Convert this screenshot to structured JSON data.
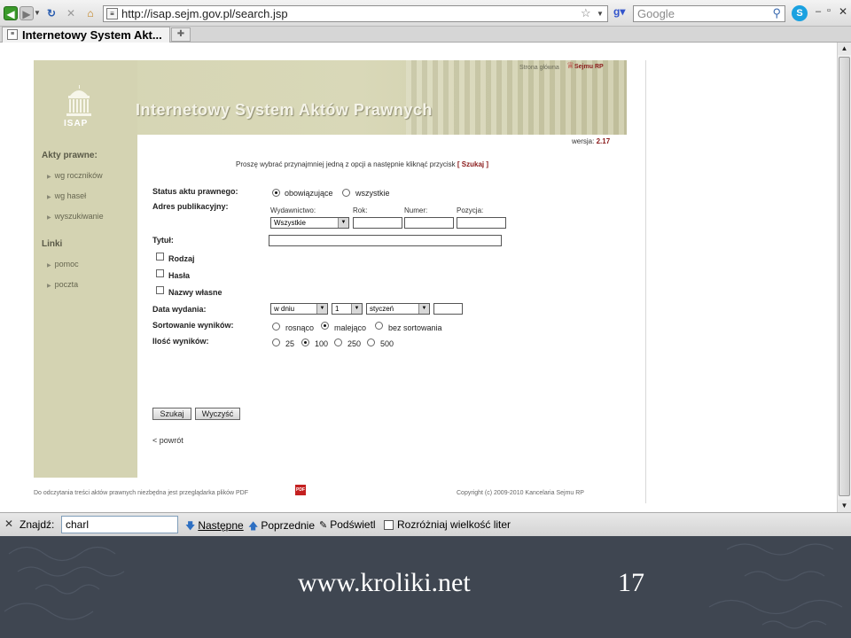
{
  "browser": {
    "url": "http://isap.sejm.gov.pl/search.jsp",
    "search_placeholder": "Google",
    "tab_title": "Internetowy System Akt..."
  },
  "site": {
    "logo_text": "ISAP",
    "title": "Internetowy System Aktów Prawnych",
    "home_link": "Strona główna",
    "sejm_link": "Sejmu RP",
    "version_label": "wersja:",
    "version_value": "2.17"
  },
  "sidebar": {
    "heading_acts": "Akty prawne:",
    "acts_items": [
      "wg roczników",
      "wg haseł",
      "wyszukiwanie"
    ],
    "heading_links": "Linki",
    "links_items": [
      "pomoc",
      "poczta"
    ]
  },
  "form": {
    "instruction": "Proszę wybrać przynajmniej jedną z opcji a następnie kliknąć przycisk",
    "instruction_button": "[ Szukaj ]",
    "status_label": "Status aktu prawnego:",
    "status_options": [
      "obowiązujące",
      "wszystkie"
    ],
    "status_selected": "obowiązujące",
    "publication_label": "Adres publikacyjny:",
    "publisher_label": "Wydawnictwo:",
    "year_label": "Rok:",
    "number_label": "Numer:",
    "position_label": "Pozycja:",
    "publisher_value": "Wszystkie",
    "title_label": "Tytuł:",
    "checkbox_type": "Rodzaj",
    "checkbox_keywords": "Hasła",
    "checkbox_names": "Nazwy własne",
    "date_label": "Data wydania:",
    "date_mode": "w dniu",
    "date_day": "1",
    "date_month": "styczeń",
    "sort_label": "Sortowanie wyników:",
    "sort_options": [
      "rosnąco",
      "malejąco",
      "bez sortowania"
    ],
    "sort_selected": "malejąco",
    "count_label": "Ilość wyników:",
    "count_options": [
      "25",
      "100",
      "250",
      "500"
    ],
    "count_selected": "100",
    "search_button": "Szukaj",
    "clear_button": "Wyczyść",
    "back_link": "< powrót"
  },
  "footer": {
    "left": "Do odczytania treści aktów prawnych niezbędna jest przeglądarka plików PDF",
    "pdf_badge": "PDF",
    "right": "Copyright (c) 2009-2010 Kancelaria Sejmu RP"
  },
  "findbar": {
    "label": "Znajdź:",
    "value": "charl",
    "next": "Następne",
    "previous": "Poprzednie",
    "highlight": "Podświetl",
    "match_case": "Rozróżniaj wielkość liter"
  },
  "slide": {
    "url": "www.kroliki.net",
    "page_number": "17"
  }
}
